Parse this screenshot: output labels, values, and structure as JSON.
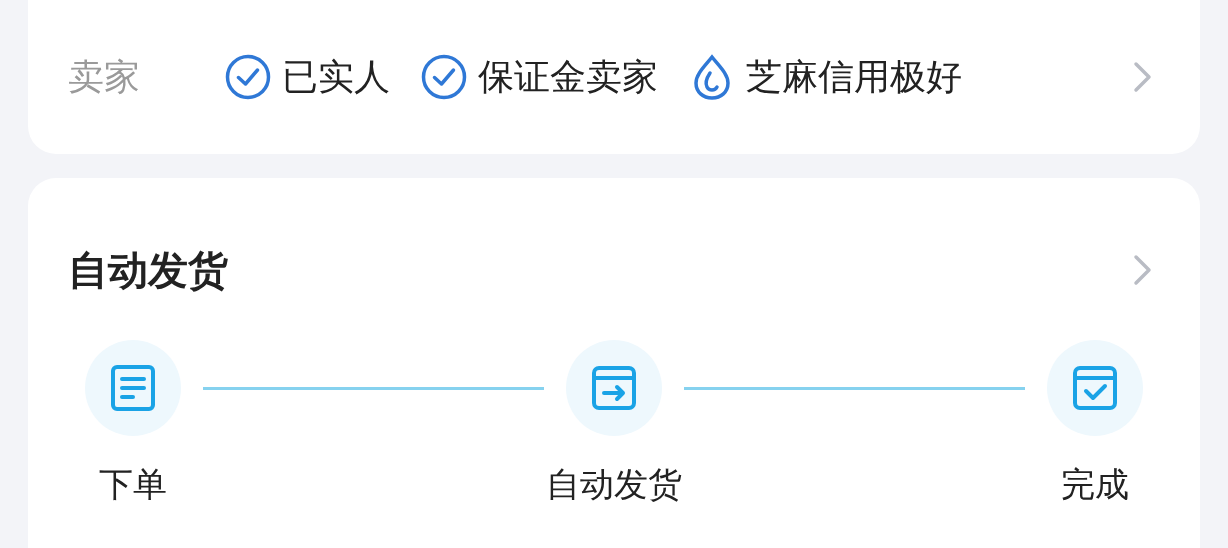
{
  "seller_card": {
    "label": "卖家",
    "badges": [
      {
        "kind": "check",
        "text": "已实人"
      },
      {
        "kind": "check",
        "text": "保证金卖家"
      },
      {
        "kind": "drop",
        "text": "芝麻信用极好"
      }
    ],
    "chevron": true
  },
  "delivery_card": {
    "title": "自动发货",
    "chevron": true,
    "steps": [
      {
        "kind": "order",
        "label": "下单"
      },
      {
        "kind": "ship",
        "label": "自动发货"
      },
      {
        "kind": "done",
        "label": "完成"
      }
    ]
  }
}
